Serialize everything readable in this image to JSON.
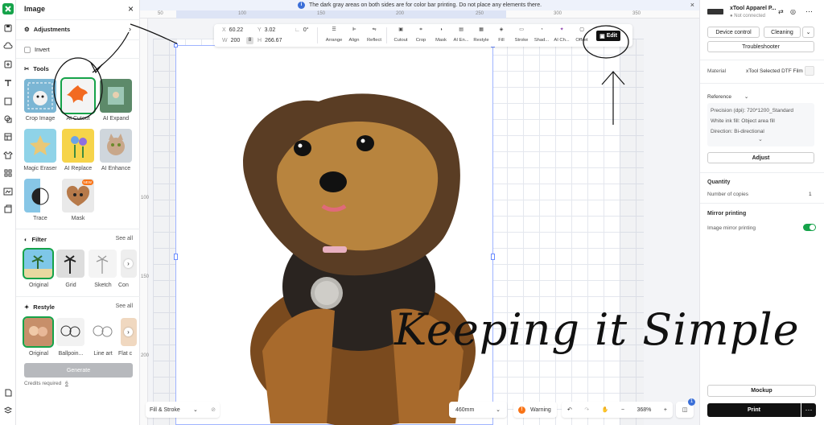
{
  "panel": {
    "title": "Image",
    "adjustments": "Adjustments",
    "invert": "Invert",
    "tools_title": "Tools",
    "tools": [
      {
        "label": "Crop Image"
      },
      {
        "label": "AI Cutout"
      },
      {
        "label": "AI Expand"
      },
      {
        "label": "Magic Eraser"
      },
      {
        "label": "AI Replace"
      },
      {
        "label": "AI Enhance"
      },
      {
        "label": "Trace"
      },
      {
        "label": "Mask",
        "badge": "NEW"
      }
    ],
    "filter_title": "Filter",
    "filter_see_all": "See all",
    "filters": [
      "Original",
      "Grid",
      "Sketch",
      "Con"
    ],
    "restyle_title": "Restyle",
    "restyle_see_all": "See all",
    "restyles": [
      "Original",
      "Ballpoin...",
      "Line art",
      "Flat c"
    ],
    "generate": "Generate",
    "credits_label": "Credits required",
    "credits_value": "6"
  },
  "banner": {
    "text": "The dark gray areas on both sides are for color bar printing. Do not place any elements there."
  },
  "ruler": {
    "top": [
      "50",
      "100",
      "150",
      "200",
      "250",
      "300",
      "350"
    ],
    "left": [
      "100",
      "150",
      "200"
    ]
  },
  "toolbar": {
    "x_label": "X",
    "x": "60.22",
    "y_label": "Y",
    "y": "3.02",
    "rot": "0°",
    "w_label": "W",
    "w": "200",
    "h_label": "H",
    "h": "266.67",
    "items": [
      "Arrange",
      "Align",
      "Reflect",
      "Cutout",
      "Crop",
      "Mask",
      "AI En...",
      "Restyle",
      "Fill",
      "Stroke",
      "Shad...",
      "AI Ch...",
      "Offset"
    ],
    "edit": "Edit"
  },
  "bottom": {
    "fill_stroke": "Fill & Stroke",
    "size": "460mm",
    "warning": "Warning",
    "zoom": "368%",
    "badge": "1"
  },
  "right": {
    "device_name": "xTool Apparel P...",
    "device_status": "Not connected",
    "device_control": "Device control",
    "cleaning": "Cleaning",
    "troubleshooter": "Troubleshooter",
    "material_label": "Material",
    "material_value": "xTool Selected DTF Film",
    "reference": "Reference",
    "precision": "Precision (dpi): 720*1200_Standard",
    "white_ink": "White ink fill: Object area fill",
    "direction": "Direction: Bi-directional",
    "adjust": "Adjust",
    "quantity_title": "Quantity",
    "copies_label": "Number of copies",
    "copies_value": "1",
    "mirror_title": "Mirror printing",
    "mirror_label": "Image mirror printing",
    "mirror_on": true,
    "mockup": "Mockup",
    "print": "Print"
  },
  "annotation": {
    "handwriting": "Keeping it Simple"
  },
  "colors": {
    "accent_green": "#16a34a",
    "toolbar_black": "#111111",
    "warning_orange": "#f97316",
    "info_blue": "#3b6fd8"
  }
}
